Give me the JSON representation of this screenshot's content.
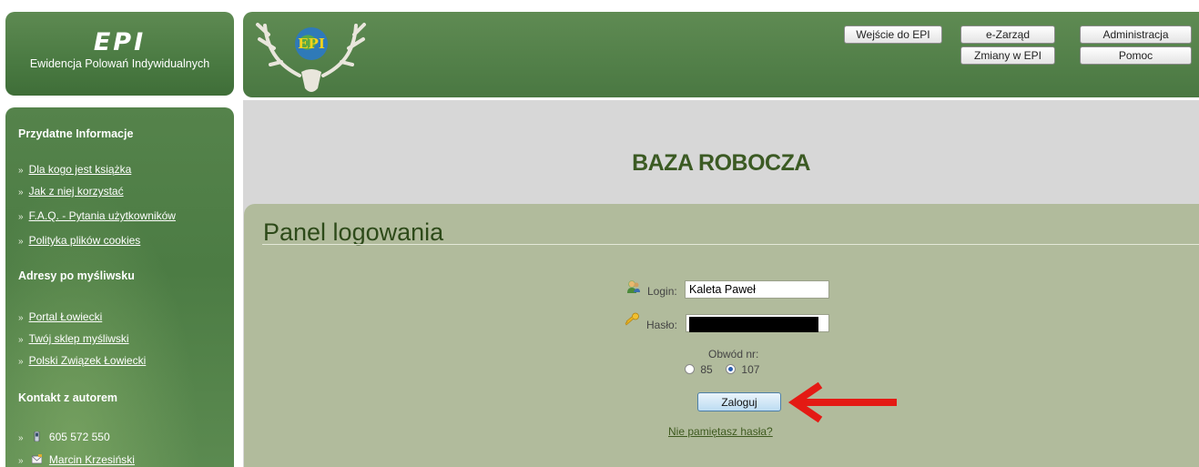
{
  "logo": {
    "title": "EPI",
    "subtitle": "Ewidencja Polowań Indywidualnych",
    "emblem_text": "EPI"
  },
  "nav": {
    "wejscie": "Wejście do EPI",
    "ezarzad": "e-Zarząd",
    "administracja": "Administracja",
    "zmiany": "Zmiany w EPI",
    "pomoc": "Pomoc"
  },
  "sidebar": {
    "section1": {
      "title": "Przydatne Informacje",
      "links": [
        "Dla kogo jest książka",
        "Jak z niej korzystać",
        "F.A.Q. - Pytania użytkowników",
        "Polityka plików cookies"
      ]
    },
    "section2": {
      "title": "Adresy po myśliwsku",
      "links": [
        "Portal Łowiecki",
        "Twój sklep myśliwski",
        "Polski Związek Łowiecki"
      ]
    },
    "section3": {
      "title": "Kontakt z autorem",
      "phone": "605 572 550",
      "name": "Marcin Krzesiński"
    },
    "bullet": "»"
  },
  "main": {
    "heading": "BAZA ROBOCZA",
    "panel_title": "Panel logowania",
    "login_label": "Login:",
    "login_value": "Kaleta Paweł",
    "password_label": "Hasło:",
    "obwod_label": "Obwód nr:",
    "obwod_options": [
      "85",
      "107"
    ],
    "obwod_selected": "107",
    "submit_label": "Zaloguj",
    "forgot_label": "Nie pamiętasz hasła?"
  },
  "colors": {
    "header_green": "#4f7e46",
    "panel": "#b1bb9c",
    "heading": "#3b5a23",
    "arrow": "#e41a14"
  }
}
